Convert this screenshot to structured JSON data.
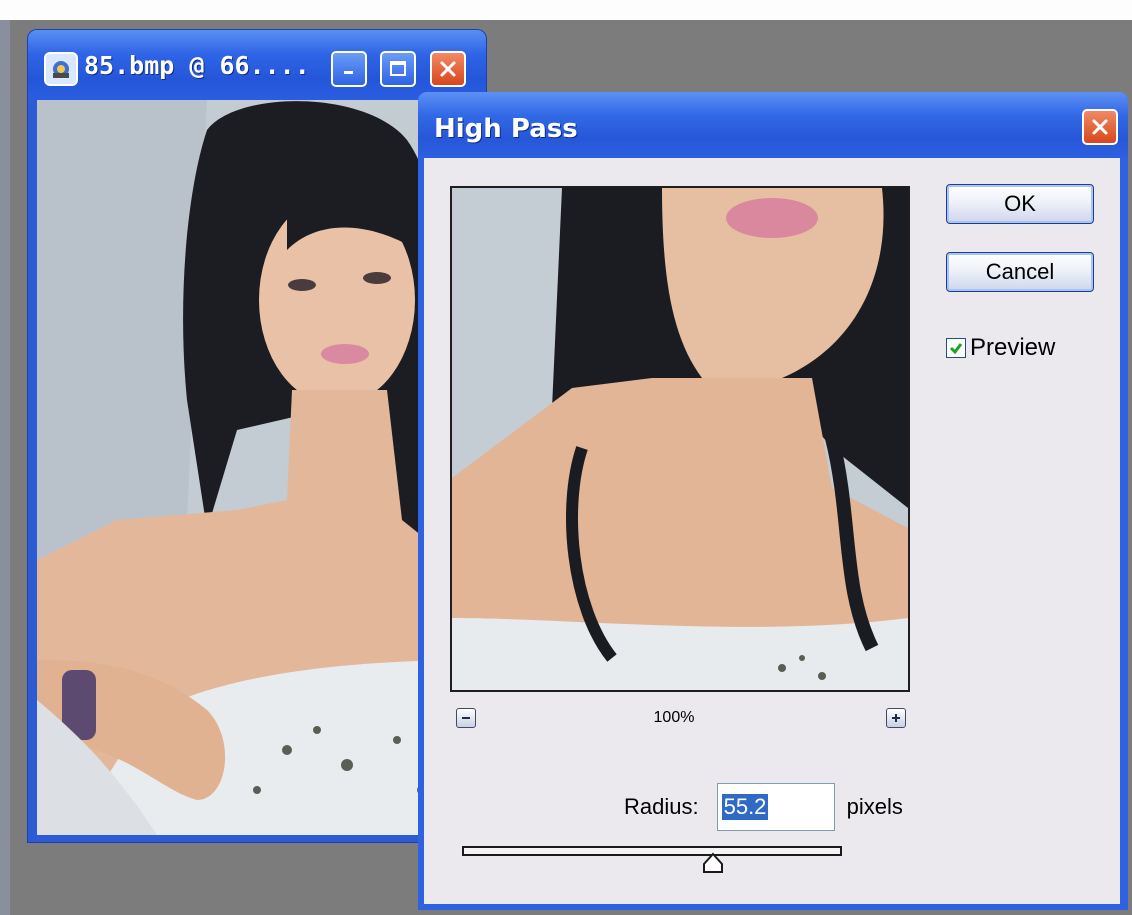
{
  "document_window": {
    "title": "85.bmp @ 66....",
    "icons": [
      "photoshop-document-icon",
      "minimize-icon",
      "maximize-icon",
      "close-icon"
    ]
  },
  "dialog": {
    "title": "High Pass",
    "ok_label": "OK",
    "cancel_label": "Cancel",
    "preview_checkbox": {
      "label": "Preview",
      "checked": true
    },
    "zoom_level": "100%",
    "radius": {
      "label": "Radius:",
      "value": "55.2",
      "unit": "pixels",
      "slider_position": 0.66
    }
  },
  "colors": {
    "titlebar_blue": "#2f62e0",
    "dialog_face": "#ebe8ee",
    "close_red": "#d8461c",
    "selection_blue": "#316ac5"
  }
}
